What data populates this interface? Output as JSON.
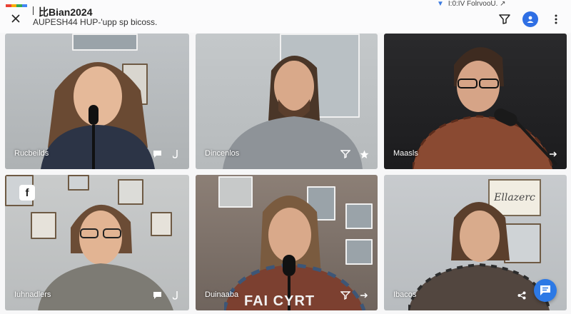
{
  "header": {
    "title": "比Bian2024",
    "subtitle": "AUPESH44 HUP-'upp sp bicoss.",
    "status_text": "I:0:IV FolrvooU. ↗",
    "brand_colors": [
      "#e94235",
      "#f9ab00",
      "#34a853",
      "#4285f4"
    ]
  },
  "tiles": [
    {
      "name": "Rucbeilds",
      "actions": [
        "chat-icon",
        "mic-icon"
      ]
    },
    {
      "name": "Dincenlos",
      "actions": [
        "filter-icon",
        "star-icon"
      ]
    },
    {
      "name": "Maasls",
      "actions": [
        "arrow-icon"
      ]
    },
    {
      "name": "Iuhnadlers",
      "actions": [
        "chat-icon",
        "mic-icon"
      ],
      "badge": "f"
    },
    {
      "name": "Duinaaba",
      "actions": [
        "filter-icon",
        "arrow-icon"
      ],
      "shirt": "FAI CYRT"
    },
    {
      "name": "Ibacos",
      "actions": [
        "share-icon"
      ],
      "sign": "Ellazerc"
    }
  ],
  "colors": {
    "accent": "#2f6fe4",
    "fab": "#2d79e5"
  }
}
